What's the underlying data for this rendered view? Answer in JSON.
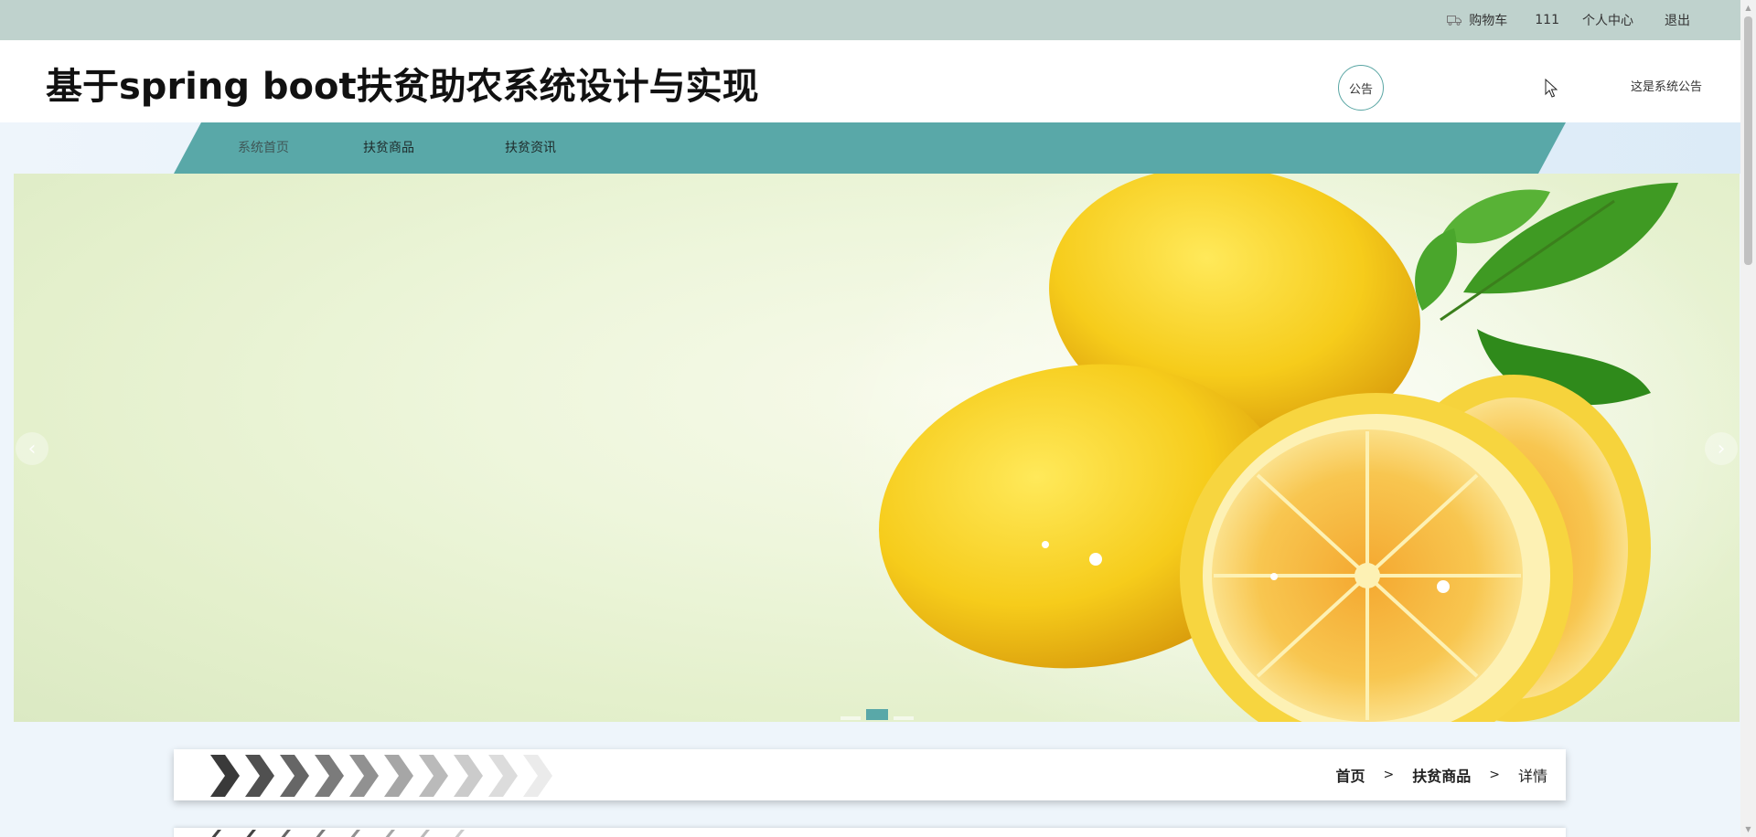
{
  "topbar": {
    "cart_label": "购物车",
    "username": "111",
    "profile_label": "个人中心",
    "logout_label": "退出"
  },
  "header": {
    "site_title": "基于spring boot扶贫助农系统设计与实现",
    "notice_button": "公告",
    "notice_ticker": "这是系统公告"
  },
  "nav": {
    "items": [
      {
        "label": "系统首页"
      },
      {
        "label": "扶贫商品"
      },
      {
        "label": "扶贫资讯"
      }
    ]
  },
  "carousel": {
    "prev_label": "‹",
    "next_label": "›",
    "slide_count": 3,
    "active_index": 1
  },
  "breadcrumb": {
    "home": "首页",
    "separator": ">",
    "category": "扶贫商品",
    "current": "详情"
  },
  "colors": {
    "accent": "#59a8a8",
    "topbar": "#bfd2cd",
    "page_bg": "#eef5fb"
  }
}
